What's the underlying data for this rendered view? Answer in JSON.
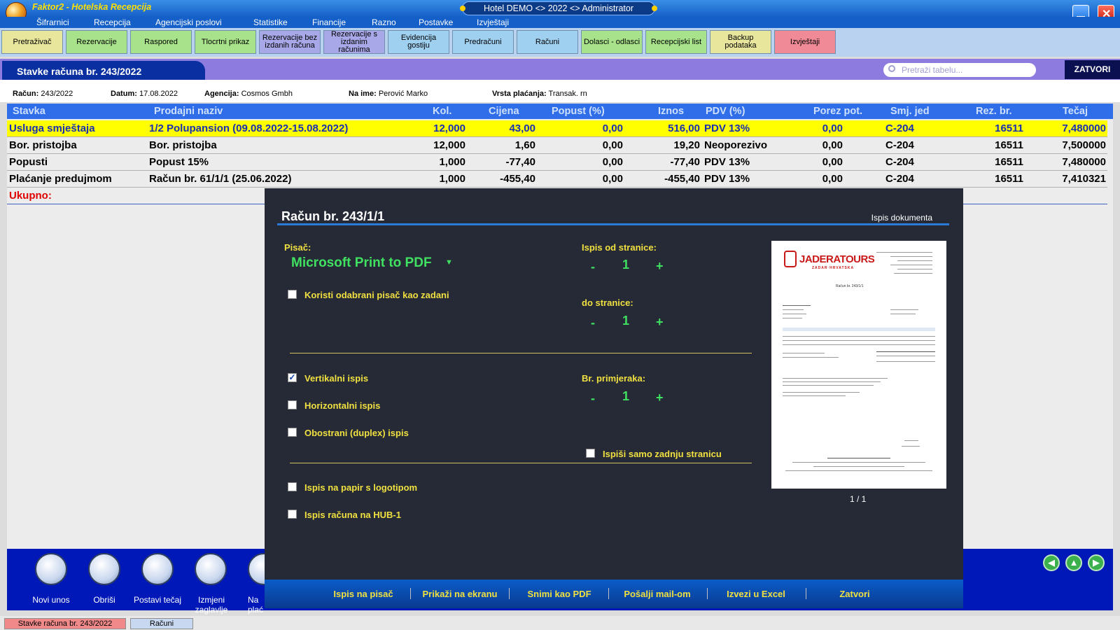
{
  "app": {
    "title": "Faktor2 - Hotelska Recepcija",
    "center_title": "Hotel DEMO <> 2022 <> Administrator"
  },
  "menu": [
    "Šifrarnici",
    "Recepcija",
    "Agencijski poslovi",
    "Statistike",
    "Financije",
    "Razno",
    "Postavke",
    "Izvještaji"
  ],
  "toolbar": {
    "buttons": [
      "Pretraživač",
      "Rezervacije",
      "Raspored",
      "Tlocrtni prikaz",
      "Rezervacije bez izdanih računa",
      "Rezervacije s izdanim računima",
      "Evidencija gostiju",
      "Predračuni",
      "Računi",
      "Dolasci - odlasci",
      "Recepcijski list",
      "Backup podataka",
      "Izvještaji"
    ]
  },
  "header": {
    "title": "Stavke računa br. 243/2022",
    "search_placeholder": "Pretraži tabelu...",
    "close_label": "ZATVORI"
  },
  "info": {
    "racun_label": "Račun:",
    "racun": "243/2022",
    "datum_label": "Datum:",
    "datum": "17.08.2022",
    "agencija_label": "Agencija:",
    "agencija": "Cosmos Gmbh",
    "naime_label": "Na ime:",
    "naime": "Perović Marko",
    "placanje_label": "Vrsta plaćanja:",
    "placanje": "Transak. rn"
  },
  "grid": {
    "columns": [
      "Stavka",
      "Prodajni naziv",
      "Kol.",
      "Cijena",
      "Popust (%)",
      "Iznos",
      "PDV (%)",
      "Porez pot.",
      "Smj. jed",
      "Rez. br.",
      "Tečaj"
    ],
    "rows": [
      [
        "Usluga smještaja",
        "1/2 Polupansion (09.08.2022-15.08.2022)",
        "12,000",
        "43,00",
        "0,00",
        "516,00",
        "PDV 13%",
        "0,00",
        "C-204",
        "16511",
        "7,480000"
      ],
      [
        "Bor. pristojba",
        "Bor. pristojba",
        "12,000",
        "1,60",
        "0,00",
        "19,20",
        "Neoporezivo",
        "0,00",
        "C-204",
        "16511",
        "7,500000"
      ],
      [
        "Popusti",
        "Popust 15%",
        "1,000",
        "-77,40",
        "0,00",
        "-77,40",
        "PDV 13%",
        "0,00",
        "C-204",
        "16511",
        "7,480000"
      ],
      [
        "Plaćanje predujmom",
        "Račun br. 61/1/1 (25.06.2022)",
        "1,000",
        "-455,40",
        "0,00",
        "-455,40",
        "PDV 13%",
        "0,00",
        "C-204",
        "16511",
        "7,410321"
      ]
    ],
    "total_label": "Ukupno:"
  },
  "bottom": {
    "buttons": [
      "Novi unos",
      "Obriši",
      "Postavi tečaj",
      "Izmjeni zaglavlje",
      "Na plać"
    ]
  },
  "status_tabs": [
    "Stavke računa br. 243/2022",
    "Računi"
  ],
  "modal": {
    "title": "Račun br. 243/1/1",
    "subtitle": "Ispis dokumenta",
    "printer_label": "Pisač:",
    "printer": "Microsoft Print to PDF",
    "default_printer": "Koristi odabrani pisač kao zadani",
    "from_page_label": "Ispis od stranice:",
    "from_page": "1",
    "to_page_label": "do stranice:",
    "to_page": "1",
    "vertical": "Vertikalni ispis",
    "horizontal": "Horizontalni ispis",
    "duplex": "Obostrani (duplex) ispis",
    "copies_label": "Br. primjeraka:",
    "copies": "1",
    "last_page_only": "Ispiši samo zadnju stranicu",
    "logo_paper": "Ispis na papir s logotipom",
    "hub": "Ispis računa na HUB-1",
    "minus": "-",
    "plus": "+",
    "preview_page": "1 / 1",
    "preview": {
      "company": "JADERATOURS",
      "tagline": "ZADAR·HRVATSKA",
      "doc_title": "Račun br. 243/1/1"
    },
    "footer": [
      "Ispis na pisač",
      "Prikaži na ekranu",
      "Snimi kao PDF",
      "Pošalji mail-om",
      "Izvezi u Excel",
      "Zatvori"
    ]
  },
  "colors": {
    "highlight_row": "#ffff00",
    "grid_header": "#2f6ee8",
    "modal_bg": "#252a36",
    "accent_yellow": "#f0e040",
    "accent_green": "#40e060"
  }
}
